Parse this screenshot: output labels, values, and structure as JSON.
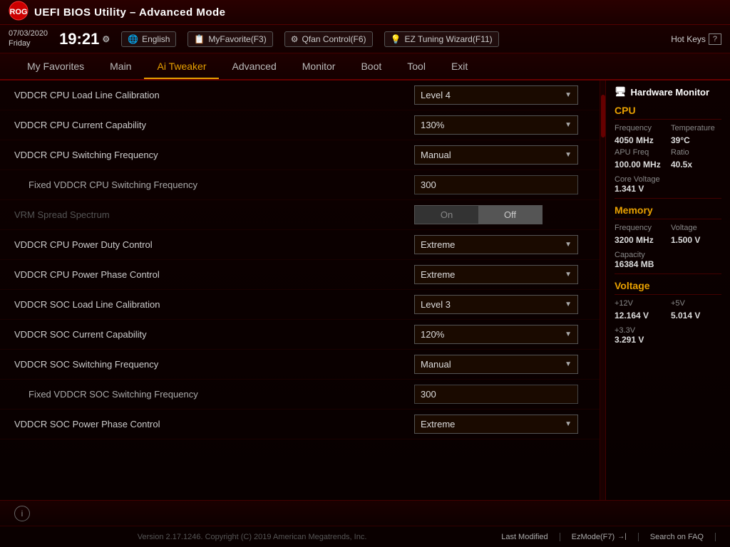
{
  "header": {
    "logo_alt": "ROG Logo",
    "title": "UEFI BIOS Utility – Advanced Mode"
  },
  "topbar": {
    "date": "07/03/2020",
    "day": "Friday",
    "time": "19:21",
    "gear_label": "⚙",
    "language_btn": "English",
    "myfavorite_btn": "MyFavorite(F3)",
    "qfan_btn": "Qfan Control(F6)",
    "eztuning_btn": "EZ Tuning Wizard(F11)",
    "hotkeys_btn": "Hot Keys",
    "help_icon": "?"
  },
  "nav": {
    "tabs": [
      {
        "label": "My Favorites",
        "active": false
      },
      {
        "label": "Main",
        "active": false
      },
      {
        "label": "Ai Tweaker",
        "active": true
      },
      {
        "label": "Advanced",
        "active": false
      },
      {
        "label": "Monitor",
        "active": false
      },
      {
        "label": "Boot",
        "active": false
      },
      {
        "label": "Tool",
        "active": false
      },
      {
        "label": "Exit",
        "active": false
      }
    ]
  },
  "settings": [
    {
      "label": "VDDCR CPU Load Line Calibration",
      "type": "dropdown",
      "value": "Level 4",
      "indented": false,
      "disabled": false
    },
    {
      "label": "VDDCR CPU Current Capability",
      "type": "dropdown",
      "value": "130%",
      "indented": false,
      "disabled": false
    },
    {
      "label": "VDDCR CPU Switching Frequency",
      "type": "dropdown",
      "value": "Manual",
      "indented": false,
      "disabled": false
    },
    {
      "label": "Fixed VDDCR CPU Switching Frequency",
      "type": "input",
      "value": "300",
      "indented": true,
      "disabled": false
    },
    {
      "label": "VRM Spread Spectrum",
      "type": "toggle",
      "value": "Off",
      "indented": false,
      "disabled": true
    },
    {
      "label": "VDDCR CPU Power Duty Control",
      "type": "dropdown",
      "value": "Extreme",
      "indented": false,
      "disabled": false
    },
    {
      "label": "VDDCR CPU Power Phase Control",
      "type": "dropdown",
      "value": "Extreme",
      "indented": false,
      "disabled": false
    },
    {
      "label": "VDDCR SOC Load Line Calibration",
      "type": "dropdown",
      "value": "Level 3",
      "indented": false,
      "disabled": false
    },
    {
      "label": "VDDCR SOC Current Capability",
      "type": "dropdown",
      "value": "120%",
      "indented": false,
      "disabled": false
    },
    {
      "label": "VDDCR SOC Switching Frequency",
      "type": "dropdown",
      "value": "Manual",
      "indented": false,
      "disabled": false
    },
    {
      "label": "Fixed VDDCR SOC Switching Frequency",
      "type": "input",
      "value": "300",
      "indented": true,
      "disabled": false
    },
    {
      "label": "VDDCR SOC Power Phase Control",
      "type": "dropdown",
      "value": "Extreme",
      "indented": false,
      "disabled": false
    }
  ],
  "hw_monitor": {
    "title": "Hardware Monitor",
    "sections": {
      "cpu": {
        "title": "CPU",
        "frequency_label": "Frequency",
        "frequency_value": "4050 MHz",
        "temperature_label": "Temperature",
        "temperature_value": "39°C",
        "apu_freq_label": "APU Freq",
        "apu_freq_value": "100.00 MHz",
        "ratio_label": "Ratio",
        "ratio_value": "40.5x",
        "core_voltage_label": "Core Voltage",
        "core_voltage_value": "1.341 V"
      },
      "memory": {
        "title": "Memory",
        "frequency_label": "Frequency",
        "frequency_value": "3200 MHz",
        "voltage_label": "Voltage",
        "voltage_value": "1.500 V",
        "capacity_label": "Capacity",
        "capacity_value": "16384 MB"
      },
      "voltage": {
        "title": "Voltage",
        "plus12v_label": "+12V",
        "plus12v_value": "12.164 V",
        "plus5v_label": "+5V",
        "plus5v_value": "5.014 V",
        "plus3v_label": "+3.3V",
        "plus3v_value": "3.291 V"
      }
    }
  },
  "footer": {
    "copyright": "Version 2.17.1246. Copyright (C) 2019 American Megatrends, Inc.",
    "last_modified": "Last Modified",
    "ez_mode": "EzMode(F7)",
    "search_faq": "Search on FAQ"
  }
}
